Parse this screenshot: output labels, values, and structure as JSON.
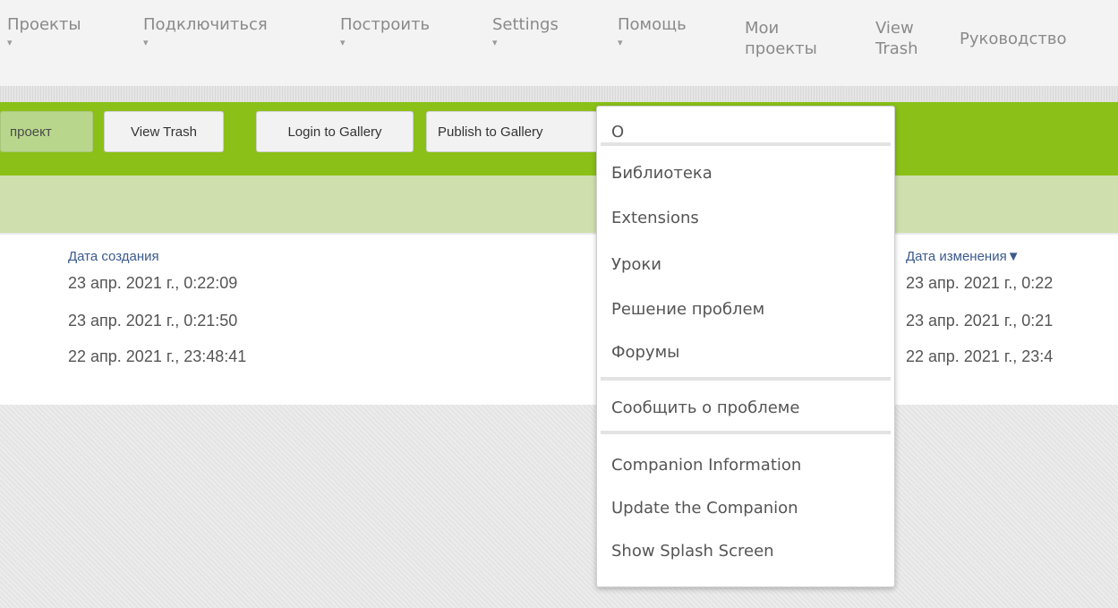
{
  "menu": {
    "items": [
      {
        "label": "Проекты"
      },
      {
        "label": "Подключиться"
      },
      {
        "label": "Построить"
      },
      {
        "label": "Settings"
      },
      {
        "label": "Помощь"
      },
      {
        "label_line1": "Мои",
        "label_line2": "проекты"
      },
      {
        "label_line1": "View",
        "label_line2": "Trash"
      },
      {
        "label": "Руководство"
      }
    ]
  },
  "toolbar": {
    "partial_button": "проект",
    "view_trash": "View Trash",
    "login_gallery": "Login to Gallery",
    "publish_gallery": "Publish to Gallery"
  },
  "table": {
    "headers": {
      "created": "Дата создания",
      "modified": "Дата изменения",
      "sort_indicator": "▼"
    },
    "rows": [
      {
        "created": "23 апр. 2021 г., 0:22:09",
        "modified": "23 апр. 2021 г., 0:22"
      },
      {
        "created": "23 апр. 2021 г., 0:21:50",
        "modified": "23 апр. 2021 г., 0:21"
      },
      {
        "created": "22 апр. 2021 г., 23:48:41",
        "modified": "22 апр. 2021 г., 23:4"
      }
    ]
  },
  "help_dropdown": {
    "items": [
      "О",
      "Библиотека",
      "Extensions",
      "Уроки",
      "Решение проблем",
      "Форумы",
      "Сообщить о проблеме",
      "Companion Information",
      "Update the Companion",
      "Show Splash Screen"
    ]
  },
  "colors": {
    "toolbar_green": "#8ac017",
    "subbar_green": "#cfe0ae",
    "header_link": "#3b5a8c"
  },
  "icons": {
    "menu_caret": "caret-down-icon"
  }
}
